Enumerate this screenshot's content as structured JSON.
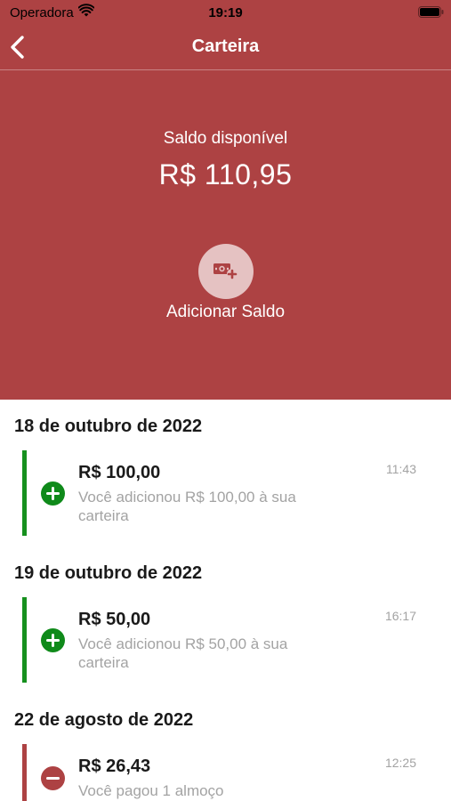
{
  "status_bar": {
    "carrier": "Operadora",
    "time": "19:19"
  },
  "nav": {
    "title": "Carteira",
    "back_icon": "chevron-left-icon"
  },
  "balance": {
    "label": "Saldo disponível",
    "value": "R$ 110,95"
  },
  "add_balance": {
    "label": "Adicionar Saldo",
    "icon": "money-plus-icon"
  },
  "groups": [
    {
      "date": "18 de outubro de 2022",
      "transactions": [
        {
          "type": "credit",
          "amount": "R$ 100,00",
          "description": "Você adicionou R$ 100,00 à sua carteira",
          "time": "11:43"
        }
      ]
    },
    {
      "date": "19 de outubro de 2022",
      "transactions": [
        {
          "type": "credit",
          "amount": "R$ 50,00",
          "description": "Você adicionou R$ 50,00 à sua carteira",
          "time": "16:17"
        }
      ]
    },
    {
      "date": "22 de agosto de 2022",
      "transactions": [
        {
          "type": "debit",
          "amount": "R$ 26,43",
          "description": "Você pagou 1 almoço",
          "time": "12:25"
        }
      ]
    }
  ],
  "colors": {
    "primary": "#ad4243",
    "credit": "#16901e",
    "muted_text": "#a3a3a3"
  }
}
